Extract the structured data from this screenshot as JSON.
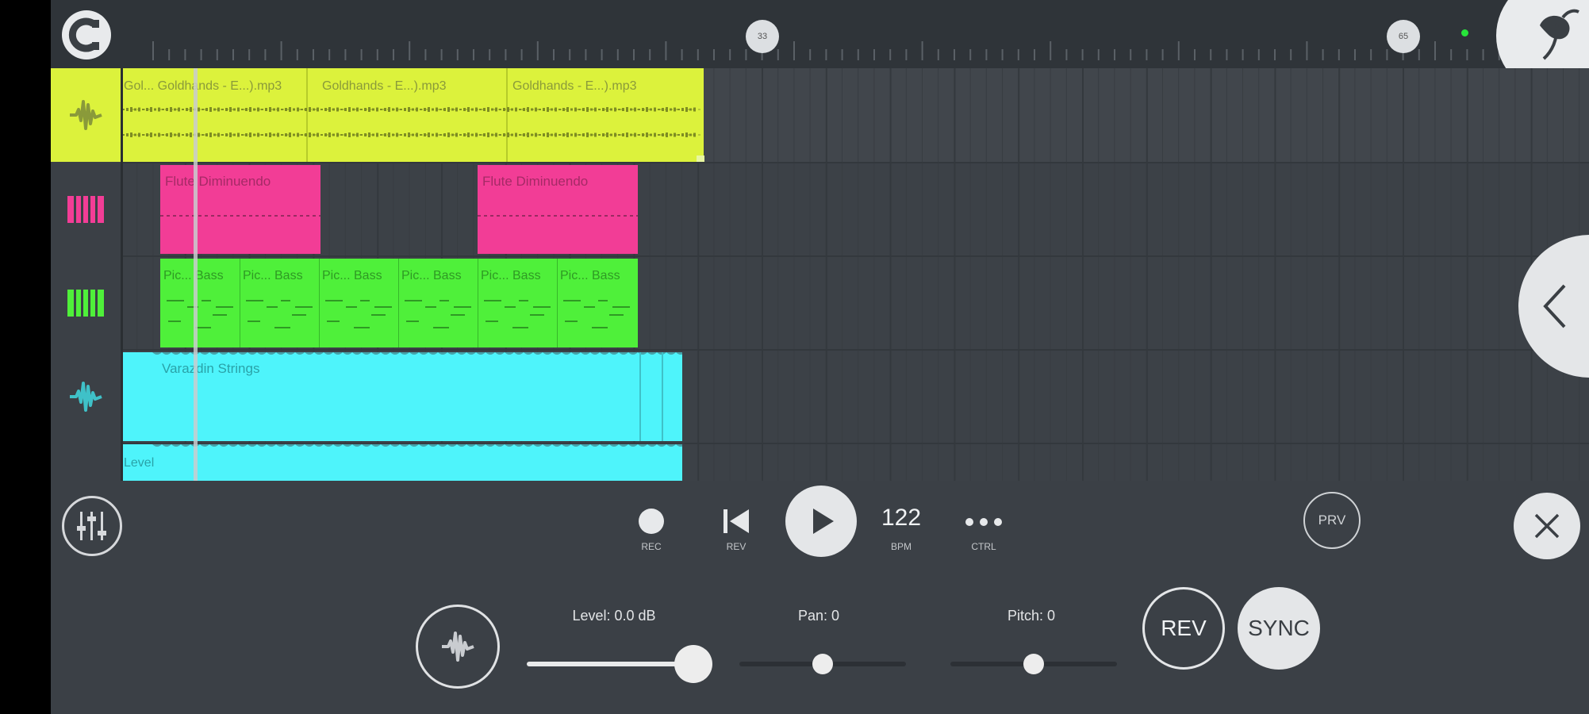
{
  "toolbar": {
    "markers": [
      "33",
      "65"
    ]
  },
  "tracks": [
    {
      "icon": "waveform-icon",
      "color": "#dcf23c"
    },
    {
      "icon": "piano-icon",
      "color": "#f23d96"
    },
    {
      "icon": "piano-icon",
      "color": "#4ff03a"
    },
    {
      "icon": "waveform-icon",
      "color": "#4ef4fb"
    }
  ],
  "clips": {
    "goldhands_1": "Gol... Goldhands - E...).mp3",
    "goldhands_2": "Goldhands - E...).mp3",
    "goldhands_3": "Goldhands - E...).mp3",
    "flute_1": "Flute Diminuendo",
    "flute_2": "Flute Diminuendo",
    "bass": [
      "Pic... Bass",
      "Pic... Bass",
      "Pic... Bass",
      "Pic... Bass",
      "Pic... Bass",
      "Pic... Bass"
    ],
    "strings": "Varazdin Strings",
    "automation": "Level"
  },
  "transport": {
    "rec_label": "REC",
    "rev_label": "REV",
    "bpm_value": "122",
    "bpm_label": "BPM",
    "ctrl_label": "CTRL",
    "prv_label": "PRV"
  },
  "sample_panel": {
    "level_label": "Level: 0.0 dB",
    "level_value": 1.0,
    "pan_label": "Pan: 0",
    "pan_value": 0.5,
    "pitch_label": "Pitch: 0",
    "pitch_value": 0.5,
    "rev_button": "REV",
    "sync_button": "SYNC"
  }
}
